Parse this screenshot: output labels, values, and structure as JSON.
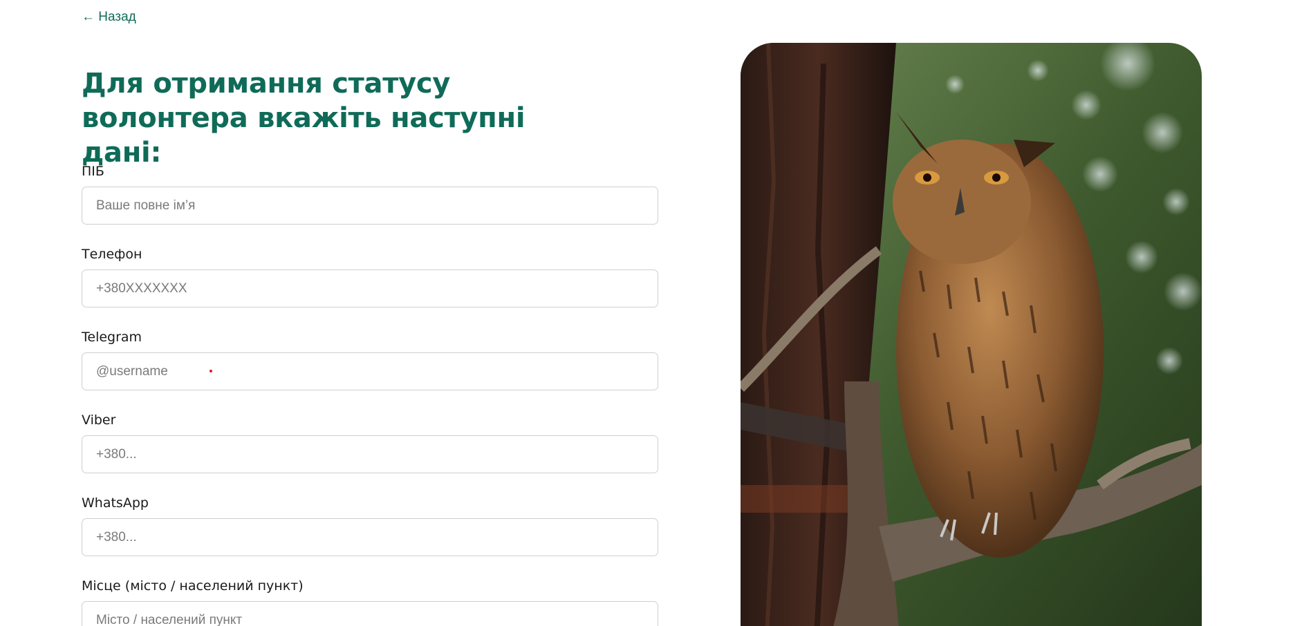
{
  "nav": {
    "back_label": "← Назад"
  },
  "form": {
    "title": "Для отримання статусу волонтера вкажіть наступні дані:",
    "fields": [
      {
        "label": "ПІБ",
        "placeholder": "Ваше повне ім’я"
      },
      {
        "label": "Телефон",
        "placeholder": "+380XXXXXXX"
      },
      {
        "label": "Telegram",
        "placeholder": "@username"
      },
      {
        "label": "Viber",
        "placeholder": "+380..."
      },
      {
        "label": "WhatsApp",
        "placeholder": "+380..."
      },
      {
        "label": "Місце (місто / населений пункт)",
        "placeholder": "Місто / населений пункт"
      }
    ]
  },
  "colors": {
    "accent": "#0f6b58",
    "input_border": "#cfcfcf",
    "marker": "#e01b1b"
  },
  "image": {
    "subject": "owl-photo"
  }
}
